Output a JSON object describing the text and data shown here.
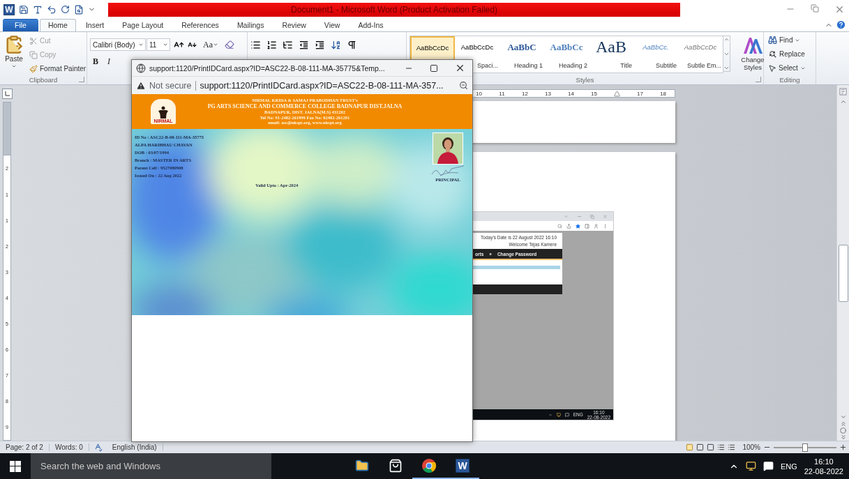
{
  "title_bar": {
    "app_icon": "W",
    "title": "Document1 - Microsoft Word (Product Activation Failed)"
  },
  "ribbon_tabs": [
    {
      "label": "File",
      "selected": false,
      "kind": "file"
    },
    {
      "label": "Home",
      "selected": true,
      "kind": "tab"
    },
    {
      "label": "Insert",
      "selected": false,
      "kind": "tab"
    },
    {
      "label": "Page Layout",
      "selected": false,
      "kind": "tab"
    },
    {
      "label": "References",
      "selected": false,
      "kind": "tab"
    },
    {
      "label": "Mailings",
      "selected": false,
      "kind": "tab"
    },
    {
      "label": "Review",
      "selected": false,
      "kind": "tab"
    },
    {
      "label": "View",
      "selected": false,
      "kind": "tab"
    },
    {
      "label": "Add-Ins",
      "selected": false,
      "kind": "tab"
    }
  ],
  "clipboard": {
    "paste": "Paste",
    "items": [
      {
        "label": "Cut",
        "disabled": true,
        "kind": "cut"
      },
      {
        "label": "Copy",
        "disabled": true,
        "kind": "copy"
      },
      {
        "label": "Format Painter",
        "disabled": false,
        "kind": "painter"
      }
    ],
    "group": "Clipboard"
  },
  "font": {
    "name": "Calibri (Body)",
    "size": "11",
    "change_case": "Aa",
    "bold": "B",
    "italic": "I"
  },
  "styles": {
    "items": [
      {
        "sample": "AaBbCcDc",
        "selected": true,
        "kind": "normal"
      },
      {
        "sample": "AaBbCcDc",
        "label": "Spaci...",
        "selected": false,
        "kind": "plain"
      },
      {
        "sample": "AaBbC",
        "label": "Heading 1",
        "selected": false,
        "kind": "heading1"
      },
      {
        "sample": "AaBbCc",
        "label": "Heading 2",
        "selected": false,
        "kind": "heading2"
      },
      {
        "sample": "AaB",
        "label": "Title",
        "selected": false,
        "kind": "title"
      },
      {
        "sample": "AaBbCc.",
        "label": "Subtitle",
        "selected": false,
        "kind": "subtitle"
      },
      {
        "sample": "AaBbCcDc",
        "label": "Subtle Em...",
        "selected": false,
        "kind": "subtle"
      }
    ],
    "change_styles": "Change Styles",
    "group": "Styles"
  },
  "editing": {
    "items": [
      {
        "label": "Find",
        "kind": "find"
      },
      {
        "label": "Replace",
        "kind": "replace"
      },
      {
        "label": "Select",
        "kind": "select"
      }
    ],
    "group": "Editing"
  },
  "horizontal_ruler": {
    "marks": [
      {
        "kind": "number",
        "label": "10"
      },
      {
        "kind": "number",
        "label": "11"
      },
      {
        "kind": "number",
        "label": "12"
      },
      {
        "kind": "number",
        "label": "13"
      },
      {
        "kind": "number",
        "label": "14"
      },
      {
        "kind": "number",
        "label": "15"
      },
      {
        "kind": "indent"
      },
      {
        "kind": "number",
        "label": "17"
      },
      {
        "kind": "number",
        "label": "18"
      }
    ]
  },
  "vertical_ruler": {
    "numbers": [
      "2",
      "1",
      "1",
      "2",
      "3",
      "4",
      "5",
      "6",
      "7",
      "8",
      "9"
    ]
  },
  "embedded_screenshot": {
    "date_text": "Today's Date is 22 August 2022 16:10",
    "welcome": "Welcome Tejas Kamere",
    "nav": [
      "orts",
      "»",
      "Change Password"
    ],
    "language": "ENG",
    "time": "16:10",
    "date": "22-08-2022"
  },
  "status_bar": {
    "page": "Page: 2 of 2",
    "words": "Words: 0",
    "language": "English (India)",
    "zoom": "100%",
    "zoom_slider": {
      "level": 0.5
    }
  },
  "taskbar": {
    "search_placeholder": "Search the web and Windows",
    "apps": [
      {
        "kind": "explorer"
      },
      {
        "kind": "store"
      },
      {
        "kind": "chrome"
      },
      {
        "kind": "word",
        "label": "W"
      }
    ],
    "language": "ENG",
    "time": "16:10",
    "date": "22-08-2022"
  },
  "popup": {
    "title": "support:1120/PrintIDCard.aspx?ID=ASC22-B-08-111-MA-35775&Temp...",
    "security": "Not secure",
    "url": "support:1120/PrintIDCard.aspx?ID=ASC22-B-08-111-MA-357...",
    "card": {
      "logo_label": "NIRMAL",
      "trust": "NIRMAL KRIDA & SAMAJ PRABODHAN TRUST's",
      "college": "PG ARTS SCIENCE AND COMMERCE COLLEGE BADNAPUR DIST.JALNA",
      "address": "BADNAPUR, DIST. JALNA(M.S) 431202",
      "contact": "Tel No: 91-2482-261999 Fax No: 02482-261201",
      "email": "email: asc@nkspt.org, www.nkspt.org",
      "fields": [
        "ID No : ASC22-B-08-111-MA-35775",
        "ALPA HARIBHAU CHAVAN",
        "DOB : 03/07/1994",
        "Branch : MASTER IN ARTS",
        "Parent Cell : 9527080908",
        "Issued On : 22 Aug 2022"
      ],
      "valid": "Valid Upto : Apr-2024",
      "signatory": "PRINCIPAL"
    }
  }
}
